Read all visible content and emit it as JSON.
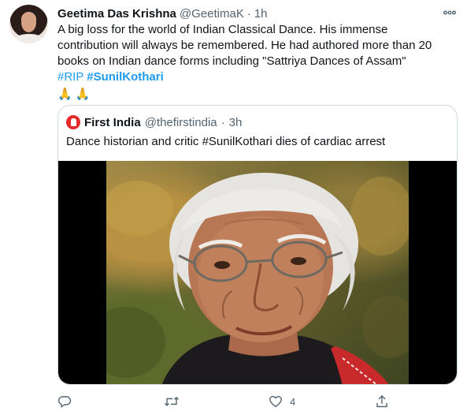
{
  "tweet": {
    "author": {
      "display_name": "Geetima Das Krishna",
      "handle": "@GeetimaK",
      "separator": "·",
      "time": "1h",
      "avatar_icon": "profile-photo-woman"
    },
    "more_icon": "more-horizontal-icon",
    "text_lines": [
      "A big loss for the world of Indian Classical Dance. His immense",
      "contribution will always be remembered. He had authored more than 20",
      "books on Indian dance forms including \"Sattriya Dances of Assam\""
    ],
    "hashtags": {
      "rip": "#RIP",
      "kothari": "#SunilKothari"
    },
    "emojis": [
      "🙏",
      "🙏"
    ]
  },
  "quoted": {
    "author": {
      "display_name": "First India",
      "handle": "@thefirstindia",
      "separator": "·",
      "time": "3h",
      "avatar_icon": "first-india-logo"
    },
    "text": "Dance historian and critic #SunilKothari dies of cardiac arrest",
    "media_description_icon": "photo-elderly-man-glasses"
  },
  "actions": {
    "reply": {
      "icon": "reply-icon",
      "count": ""
    },
    "retweet": {
      "icon": "retweet-icon",
      "count": ""
    },
    "like": {
      "icon": "like-icon",
      "count": "4"
    },
    "share": {
      "icon": "share-icon",
      "count": ""
    }
  },
  "colors": {
    "link": "#1d9bf0",
    "text": "#0f1419",
    "muted": "#536471",
    "border": "#cfd9de"
  }
}
